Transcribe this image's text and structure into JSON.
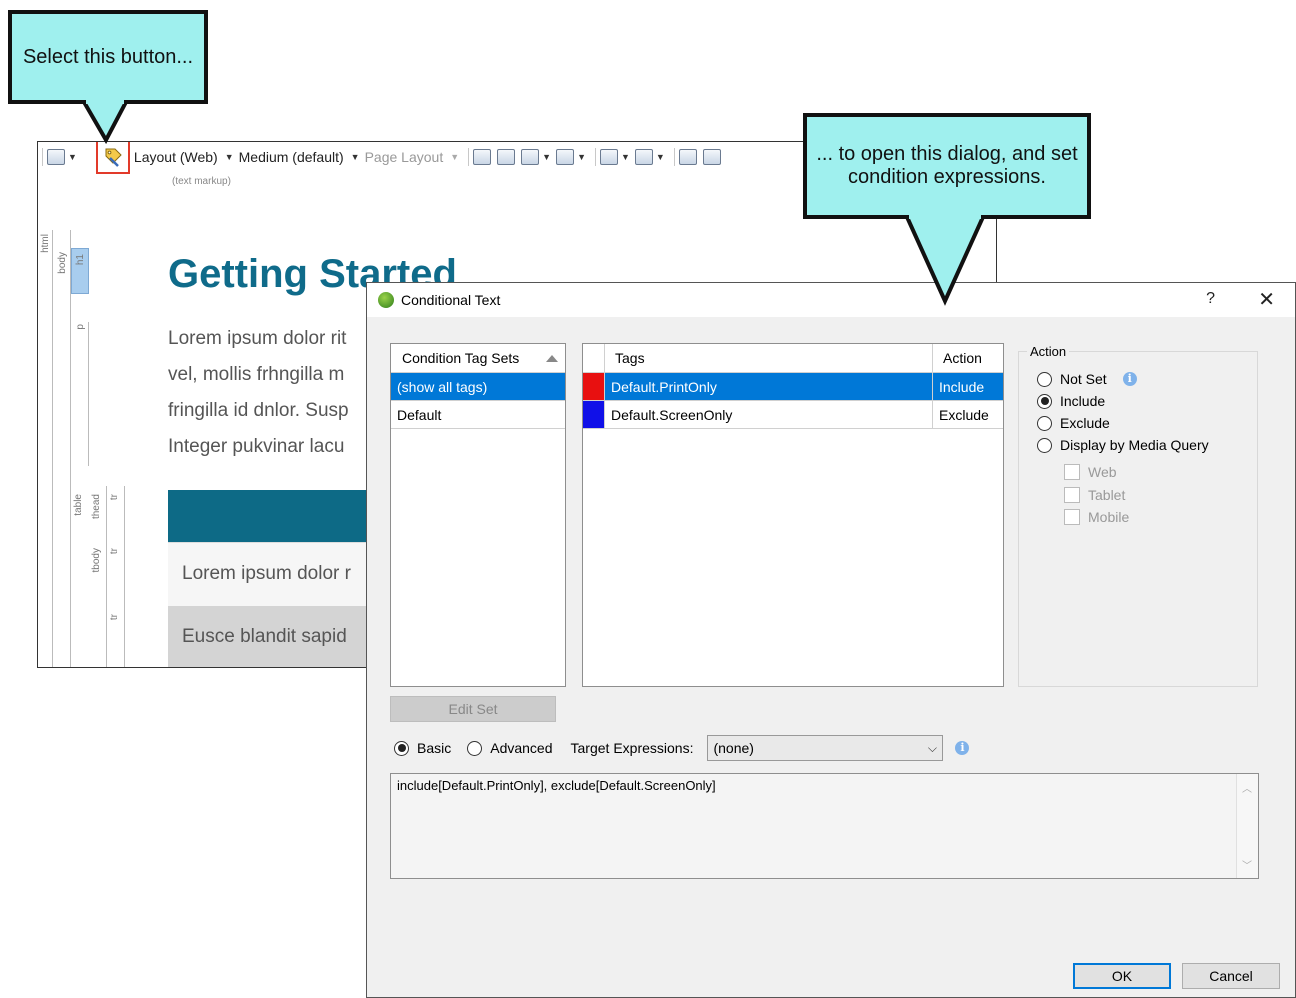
{
  "callouts": {
    "select": "Select this button...",
    "dialog": "... to open this dialog, and set condition expressions."
  },
  "editor": {
    "toolbar": {
      "layout_label": "Layout (Web)",
      "medium_label": "Medium (default)",
      "page_layout_label": "Page Layout"
    },
    "text_markup_label": "(text markup)",
    "structure_labels": [
      "html",
      "body",
      "h1",
      "p",
      "table",
      "thead",
      "tr",
      "tbody",
      "tr",
      "tr"
    ],
    "heading": "Getting Started",
    "paragraph_lines": [
      "Lorem ipsum dolor rit",
      "vel, mollis frhngilla m",
      "fringilla id dnlor. Susp",
      "Integer pukvinar lacu"
    ],
    "table_rows": [
      "Lorem ipsum dolor r",
      "Eusce blandit sapid"
    ]
  },
  "dialog": {
    "title": "Conditional Text",
    "help": "?",
    "close": "✕",
    "sets_header": "Condition Tag Sets",
    "sets": [
      {
        "label": "(show all tags)",
        "selected": true
      },
      {
        "label": "Default",
        "selected": false
      }
    ],
    "tags_header": "Tags",
    "action_header": "Action",
    "tags": [
      {
        "name": "Default.PrintOnly",
        "action": "Include",
        "color": "#e81010",
        "selected": true
      },
      {
        "name": "Default.ScreenOnly",
        "action": "Exclude",
        "color": "#1010e8",
        "selected": false
      }
    ],
    "action_group": {
      "legend": "Action",
      "options": [
        "Not Set",
        "Include",
        "Exclude",
        "Display by Media Query"
      ],
      "selected": "Include",
      "media": [
        "Web",
        "Tablet",
        "Mobile"
      ]
    },
    "edit_set_label": "Edit Set",
    "mode": {
      "basic": "Basic",
      "advanced": "Advanced",
      "selected": "Basic"
    },
    "target_label": "Target Expressions:",
    "target_value": "(none)",
    "expression": "include[Default.PrintOnly], exclude[Default.ScreenOnly]",
    "ok_label": "OK",
    "cancel_label": "Cancel"
  }
}
